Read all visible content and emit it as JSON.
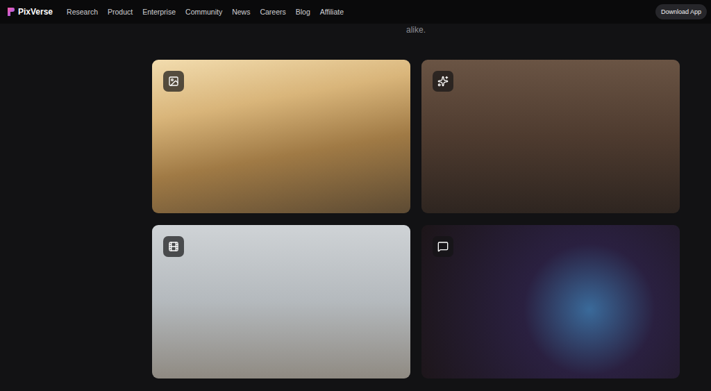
{
  "nav": {
    "logo": "PixVerse",
    "items": [
      "Research",
      "Product",
      "Enterprise",
      "Community",
      "News",
      "Careers",
      "Blog",
      "Affiliate"
    ],
    "download": "Download App"
  },
  "intro_tail": "alike.",
  "cards": [
    {
      "kind": "image"
    },
    {
      "kind": "effect"
    },
    {
      "kind": "video"
    },
    {
      "kind": "chat"
    }
  ]
}
